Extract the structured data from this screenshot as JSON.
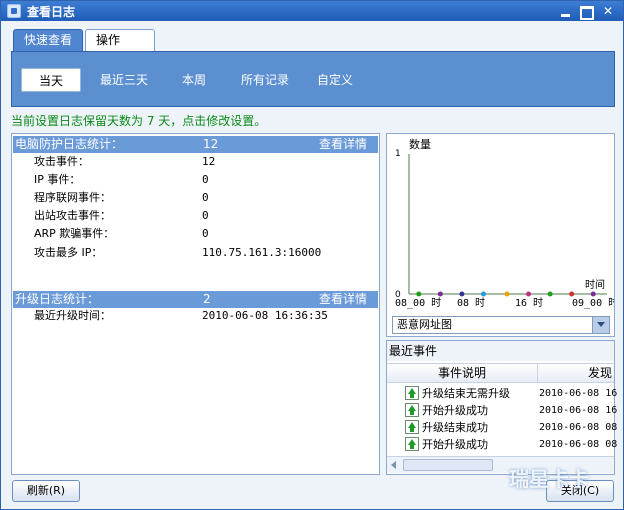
{
  "window": {
    "title": "查看日志"
  },
  "tabs": [
    {
      "label": "快速查看",
      "active": true
    },
    {
      "label": "操作",
      "active": false
    }
  ],
  "filters": [
    {
      "label": "当天",
      "active": true
    },
    {
      "label": "最近三天",
      "active": false
    },
    {
      "label": "本周",
      "active": false
    },
    {
      "label": "所有记录",
      "active": false
    },
    {
      "label": "自定义",
      "active": false
    }
  ],
  "retention_notice": "当前设置日志保留天数为 7 天，点击修改设置。",
  "protection": {
    "header_label": "电脑防护日志统计：",
    "header_count": "12",
    "details_link": "查看详情",
    "rows": [
      {
        "label": "攻击事件：",
        "value": "12"
      },
      {
        "label": "IP 事件：",
        "value": "0"
      },
      {
        "label": "程序联网事件：",
        "value": "0"
      },
      {
        "label": "出站攻击事件：",
        "value": "0"
      },
      {
        "label": "ARP 欺骗事件：",
        "value": "0"
      },
      {
        "label": "攻击最多 IP：",
        "value": "110.75.161.3:16000"
      }
    ]
  },
  "upgrade": {
    "header_label": "升级日志统计：",
    "header_count": "2",
    "details_link": "查看详情",
    "rows": [
      {
        "label": "最近升级时间：",
        "value": "2010-06-08 16:36:35"
      }
    ]
  },
  "chart_data": {
    "type": "scatter",
    "ylabel": "数量",
    "xlabel": "时间",
    "ylim": [
      0,
      1
    ],
    "y_ticks": [
      "0",
      "1"
    ],
    "x_ticks": [
      "08_00 时",
      "08 时",
      "16 时",
      "09_00 时"
    ],
    "points": [
      {
        "x": 0.05,
        "y": 0,
        "color": "#1aa11a"
      },
      {
        "x": 0.16,
        "y": 0,
        "color": "#7a2a9a"
      },
      {
        "x": 0.27,
        "y": 0,
        "color": "#333399"
      },
      {
        "x": 0.38,
        "y": 0,
        "color": "#1f9bd8"
      },
      {
        "x": 0.5,
        "y": 0,
        "color": "#f0a000"
      },
      {
        "x": 0.61,
        "y": 0,
        "color": "#c0307a"
      },
      {
        "x": 0.72,
        "y": 0,
        "color": "#1aa11a"
      },
      {
        "x": 0.83,
        "y": 0,
        "color": "#d03030"
      },
      {
        "x": 0.94,
        "y": 0,
        "color": "#7a2a9a"
      }
    ]
  },
  "chart_select": {
    "value": "恶意网址图"
  },
  "recent_events": {
    "title": "最近事件",
    "columns": [
      "事件说明",
      "发现"
    ],
    "rows": [
      {
        "desc": "升级结束无需升级",
        "time": "2010-06-08 16"
      },
      {
        "desc": "开始升级成功",
        "time": "2010-06-08 16"
      },
      {
        "desc": "升级结束成功",
        "time": "2010-06-08 08"
      },
      {
        "desc": "开始升级成功",
        "time": "2010-06-08 08"
      }
    ]
  },
  "buttons": {
    "refresh": "刷新(R)",
    "close": "关闭(C)"
  },
  "watermark": "瑞星卡卡"
}
